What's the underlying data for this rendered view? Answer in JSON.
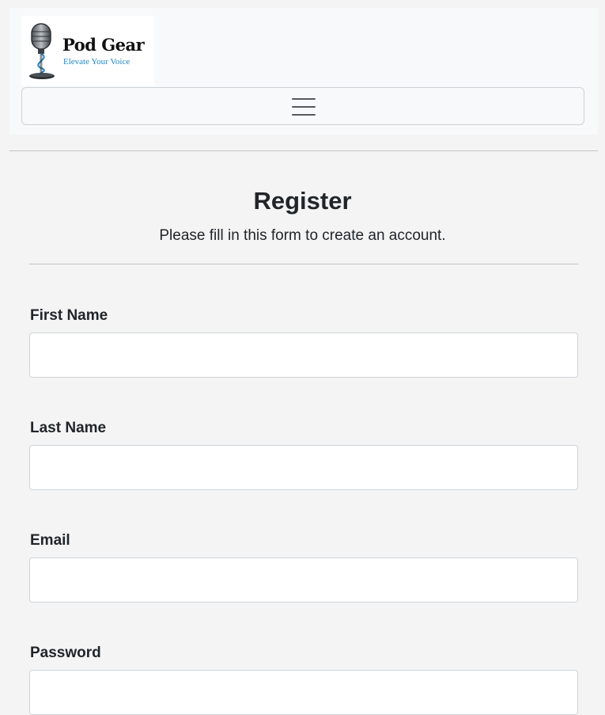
{
  "header": {
    "logo": {
      "title": "Pod Gear",
      "tagline": "Elevate Your Voice",
      "icon": "microphone-icon"
    },
    "menu_toggle_icon": "hamburger-menu-icon"
  },
  "form": {
    "title": "Register",
    "subtitle": "Please fill in this form to create an account.",
    "fields": [
      {
        "label": "First Name",
        "value": "",
        "placeholder": ""
      },
      {
        "label": "Last Name",
        "value": "",
        "placeholder": ""
      },
      {
        "label": "Email",
        "value": "",
        "placeholder": ""
      },
      {
        "label": "Password",
        "value": "",
        "placeholder": ""
      }
    ]
  },
  "colors": {
    "page_background": "#f4f4f4",
    "navbar_background": "#f8f9fa",
    "tagline": "#1e88c8",
    "text": "#212529"
  }
}
